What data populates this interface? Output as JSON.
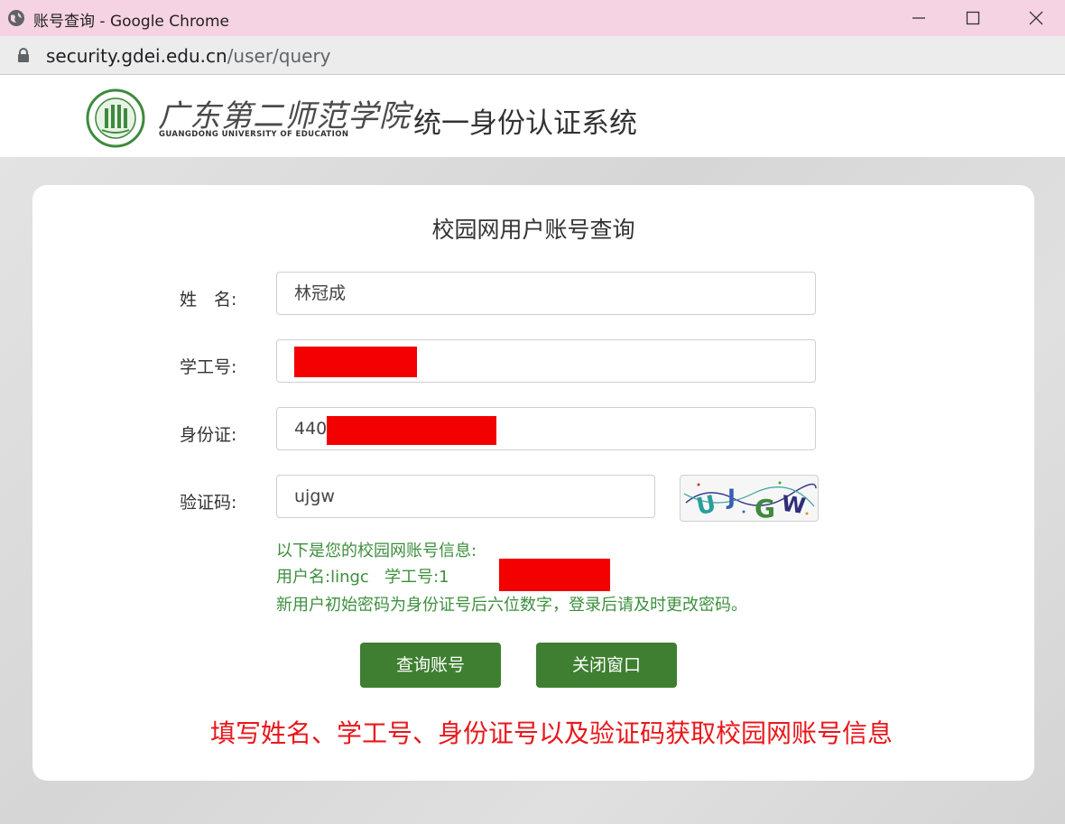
{
  "window": {
    "title": "账号查询 - Google Chrome",
    "url_host": "security.gdei.edu.cn",
    "url_path": "/user/query"
  },
  "header": {
    "school_name_cn": "广东第二师范学院",
    "school_name_en": "GUANGDONG UNIVERSITY OF EDUCATION",
    "system_title": "统一身份认证系统"
  },
  "form": {
    "title": "校园网用户账号查询",
    "name_label": "姓　名:",
    "name_value": "林冠成",
    "id_label": "学工号:",
    "idcard_label": "身份证:",
    "idcard_value": "440",
    "captcha_label": "验证码:",
    "captcha_value": "ujgw",
    "captcha_image_text": "UJGW"
  },
  "result": {
    "line1": "以下是您的校园网账号信息:",
    "username_label": "用户名:",
    "username": "lingc",
    "staff_label": "学工号:",
    "staff_value": "1",
    "line3": "新用户初始密码为身份证号后六位数字，登录后请及时更改密码。"
  },
  "buttons": {
    "query": "查询账号",
    "close": "关闭窗口"
  },
  "hint": "填写姓名、学工号、身份证号以及验证码获取校园网账号信息",
  "colors": {
    "titlebar": "#f6d3e2",
    "button_green": "#3e7f31",
    "result_green": "#3d8f3d",
    "hint_red": "#e8171b",
    "redaction": "#f30000"
  },
  "icons": [
    "globe-icon",
    "minimize-icon",
    "maximize-icon",
    "close-icon",
    "lock-icon",
    "school-seal-icon"
  ]
}
